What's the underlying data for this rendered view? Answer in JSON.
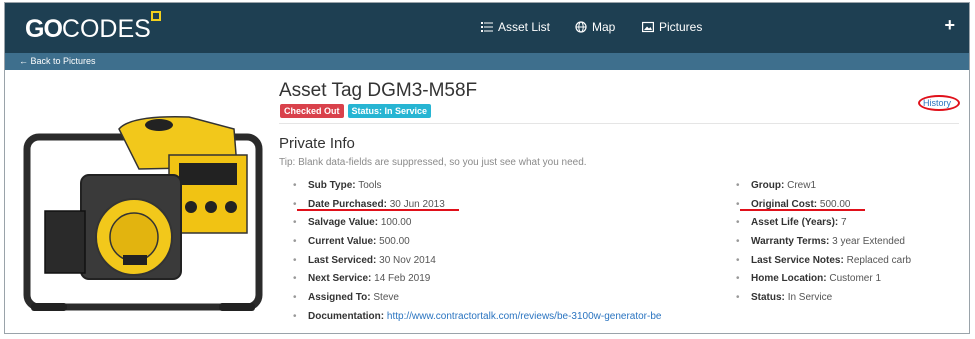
{
  "header": {
    "logo_go": "GO",
    "logo_codes": "CODES",
    "nav": [
      {
        "label": "Asset List",
        "icon": "list-icon"
      },
      {
        "label": "Map",
        "icon": "globe-icon"
      },
      {
        "label": "Pictures",
        "icon": "picture-icon"
      }
    ],
    "plus": "+"
  },
  "subbar": {
    "back_label": "← Back to Pictures"
  },
  "asset": {
    "title": "Asset Tag DGM3-M58F",
    "badges": [
      "Checked Out",
      "Status: In Service"
    ],
    "history_label": "History"
  },
  "section": {
    "title": "Private Info",
    "tip": "Tip: Blank data-fields are suppressed, so you just see what you need."
  },
  "left_fields": [
    {
      "label": "Sub Type:",
      "value": "Tools"
    },
    {
      "label": "Date Purchased:",
      "value": "30 Jun 2013"
    },
    {
      "label": "Salvage Value:",
      "value": "100.00"
    },
    {
      "label": "Current Value:",
      "value": "500.00"
    },
    {
      "label": "Last Serviced:",
      "value": "30 Nov 2014"
    },
    {
      "label": "Next Service:",
      "value": "14 Feb 2019"
    },
    {
      "label": "Assigned To:",
      "value": "Steve"
    },
    {
      "label": "Documentation:",
      "value": "http://www.contractortalk.com/reviews/be-3100w-generator-be"
    }
  ],
  "right_fields": [
    {
      "label": "Group:",
      "value": "Crew1"
    },
    {
      "label": "Original Cost:",
      "value": "500.00"
    },
    {
      "label": "Asset Life (Years):",
      "value": "7"
    },
    {
      "label": "Warranty Terms:",
      "value": "3 year Extended"
    },
    {
      "label": "Last Service Notes:",
      "value": "Replaced carb"
    },
    {
      "label": "Home Location:",
      "value": "Customer 1"
    },
    {
      "label": "Status:",
      "value": "In Service"
    }
  ],
  "colors": {
    "header": "#1e3f52",
    "subbar": "#3e6f8d",
    "checked_out": "#d9414b",
    "status": "#27b5d3",
    "annotation": "#e0101a"
  }
}
